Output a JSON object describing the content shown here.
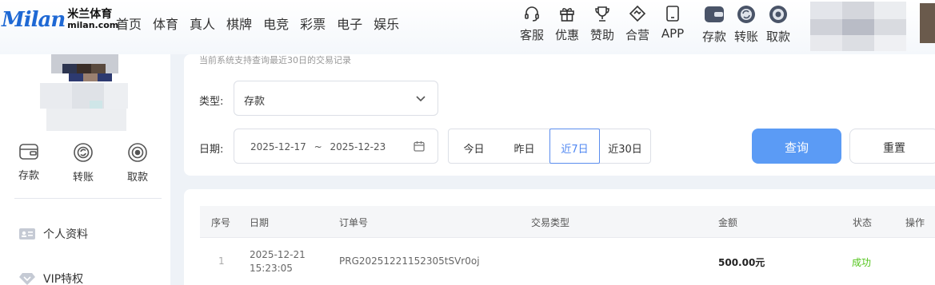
{
  "brand": {
    "mark": "Milan",
    "name_cn": "米兰体育",
    "domain": "milan.com"
  },
  "nav": [
    "首页",
    "体育",
    "真人",
    "棋牌",
    "电竞",
    "彩票",
    "电子",
    "娱乐"
  ],
  "tools": [
    {
      "label": "客服",
      "icon": "headset-icon"
    },
    {
      "label": "优惠",
      "icon": "gift-icon"
    },
    {
      "label": "赞助",
      "icon": "trophy-icon"
    },
    {
      "label": "合营",
      "icon": "handshake-icon"
    },
    {
      "label": "APP",
      "icon": "tablet-icon"
    }
  ],
  "wallet": [
    {
      "label": "存款",
      "icon": "wallet-icon"
    },
    {
      "label": "转账",
      "icon": "transfer-icon"
    },
    {
      "label": "取款",
      "icon": "withdraw-icon"
    }
  ],
  "sidebar": {
    "actions": [
      {
        "label": "存款",
        "icon": "wallet-icon"
      },
      {
        "label": "转账",
        "icon": "transfer-icon"
      },
      {
        "label": "取款",
        "icon": "withdraw-icon"
      }
    ],
    "items": [
      {
        "label": "个人资料",
        "icon": "id-card-icon"
      },
      {
        "label": "VIP特权",
        "icon": "diamond-icon"
      }
    ]
  },
  "filter": {
    "notice": "当前系统支持查询最近30日的交易记录",
    "type_label": "类型:",
    "type_value": "存款",
    "date_label": "日期:",
    "date_start": "2025-12-17",
    "date_sep": "~",
    "date_end": "2025-12-23",
    "ranges": [
      "今日",
      "昨日",
      "近7日",
      "近30日"
    ],
    "active_range": "近7日",
    "query_label": "查询",
    "reset_label": "重置"
  },
  "table": {
    "headers": [
      "序号",
      "日期",
      "订单号",
      "交易类型",
      "金额",
      "状态",
      "操作"
    ],
    "rows": [
      {
        "index": "1",
        "date": "2025-12-21",
        "time": "15:23:05",
        "order": "PRG20251221152305tSVr0oj",
        "type": "",
        "amount": "500.00元",
        "status": "成功",
        "action": ""
      }
    ]
  },
  "colors": {
    "accent": "#5b9bf5",
    "success": "#52c41a",
    "brand": "#1e68d4"
  }
}
